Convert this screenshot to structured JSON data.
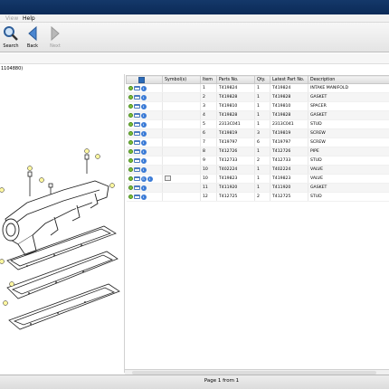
{
  "menu": {
    "items": [
      "View",
      "Help"
    ]
  },
  "toolbar": {
    "search_label": "Search",
    "back_label": "Back",
    "next_label": "Next"
  },
  "model_code": "1104880)",
  "table": {
    "columns": [
      "Symbol(s)",
      "Item",
      "Parts No.",
      "Qty.",
      "Latest Part No.",
      "Description"
    ],
    "rows": [
      {
        "item": "1",
        "part": "T419824",
        "qty": "1",
        "latest": "T419824",
        "desc": "INTAKE MANIFOLD"
      },
      {
        "item": "2",
        "part": "T419828",
        "qty": "1",
        "latest": "T419828",
        "desc": "GASKET"
      },
      {
        "item": "3",
        "part": "T419810",
        "qty": "1",
        "latest": "T419810",
        "desc": "SPACER"
      },
      {
        "item": "4",
        "part": "T419828",
        "qty": "1",
        "latest": "T419828",
        "desc": "GASKET"
      },
      {
        "item": "5",
        "part": "2313C041",
        "qty": "1",
        "latest": "2313C041",
        "desc": "STUD"
      },
      {
        "item": "6",
        "part": "T419819",
        "qty": "3",
        "latest": "T419819",
        "desc": "SCREW"
      },
      {
        "item": "7",
        "part": "T419797",
        "qty": "6",
        "latest": "T419797",
        "desc": "SCREW"
      },
      {
        "item": "8",
        "part": "T412726",
        "qty": "1",
        "latest": "T412726",
        "desc": "PIPE"
      },
      {
        "item": "9",
        "part": "T412733",
        "qty": "2",
        "latest": "T412733",
        "desc": "STUD"
      },
      {
        "item": "10",
        "part": "T402224",
        "qty": "1",
        "latest": "T402224",
        "desc": "VALVE"
      },
      {
        "item": "10",
        "part": "T419823",
        "qty": "1",
        "latest": "T419823",
        "desc": "VALVE"
      },
      {
        "item": "11",
        "part": "T411920",
        "qty": "1",
        "latest": "T411920",
        "desc": "GASKET"
      },
      {
        "item": "12",
        "part": "T412725",
        "qty": "2",
        "latest": "T412725",
        "desc": "STUD"
      }
    ]
  },
  "status": {
    "page_info": "Page 1 from 1"
  }
}
